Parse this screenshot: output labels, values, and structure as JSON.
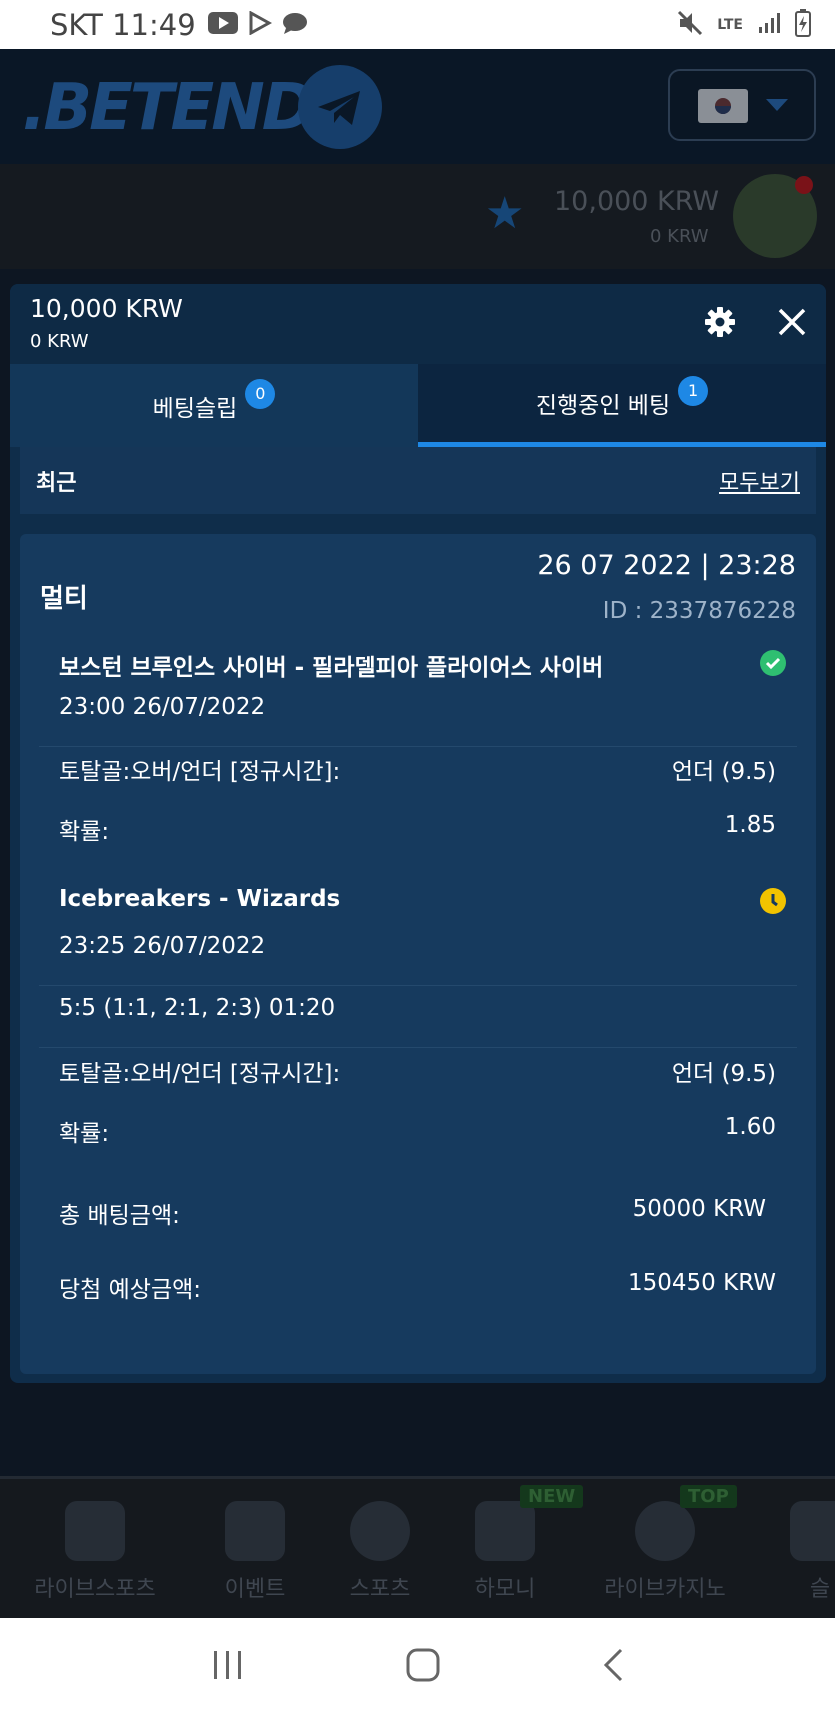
{
  "status_bar": {
    "carrier_time": "SKT 11:49",
    "network": "LTE"
  },
  "background": {
    "logo": ".BETEND",
    "balance_main": "10,000 KRW",
    "balance_sub": "0 KRW",
    "nav": [
      {
        "label": "라이브스포츠",
        "badge": ""
      },
      {
        "label": "이벤트",
        "badge": ""
      },
      {
        "label": "스포츠",
        "badge": ""
      },
      {
        "label": "하모니",
        "badge": "NEW"
      },
      {
        "label": "라이브카지노",
        "badge": "TOP"
      },
      {
        "label": "슬",
        "badge": ""
      }
    ]
  },
  "modal": {
    "balance_main": "10,000 KRW",
    "balance_sub": "0 KRW",
    "tabs": [
      {
        "label": "베팅슬립",
        "count": "0",
        "active": false
      },
      {
        "label": "진행중인 베팅",
        "count": "1",
        "active": true
      }
    ],
    "recent_label": "최근",
    "view_all": "모두보기",
    "bet": {
      "type": "멀티",
      "datetime": "26 07 2022 | 23:28",
      "id": "ID :  2337876228",
      "events": [
        {
          "title": "보스턴 브루인스 사이버 - 필라델피아 플라이어스 사이버",
          "time": "23:00   26/07/2022",
          "status": "won",
          "score": "",
          "market": "토탈골:오버/언더 [정규시간]:",
          "pick": "언더 (9.5)",
          "odds_label": "확률:",
          "odds": "1.85"
        },
        {
          "title": "Icebreakers - Wizards",
          "time": "23:25   26/07/2022",
          "status": "pending",
          "score": "5:5 (1:1, 2:1, 2:3) 01:20",
          "market": "토탈골:오버/언더 [정규시간]:",
          "pick": "언더 (9.5)",
          "odds_label": "확률:",
          "odds": "1.60"
        }
      ],
      "stake_label": "총 배팅금액:",
      "stake": "50000 KRW",
      "payout_label": "당첨 예상금액:",
      "payout": "150450 KRW"
    }
  },
  "colors": {
    "accent": "#1e88e5",
    "won": "#2fbf71",
    "pending": "#f2c300"
  }
}
